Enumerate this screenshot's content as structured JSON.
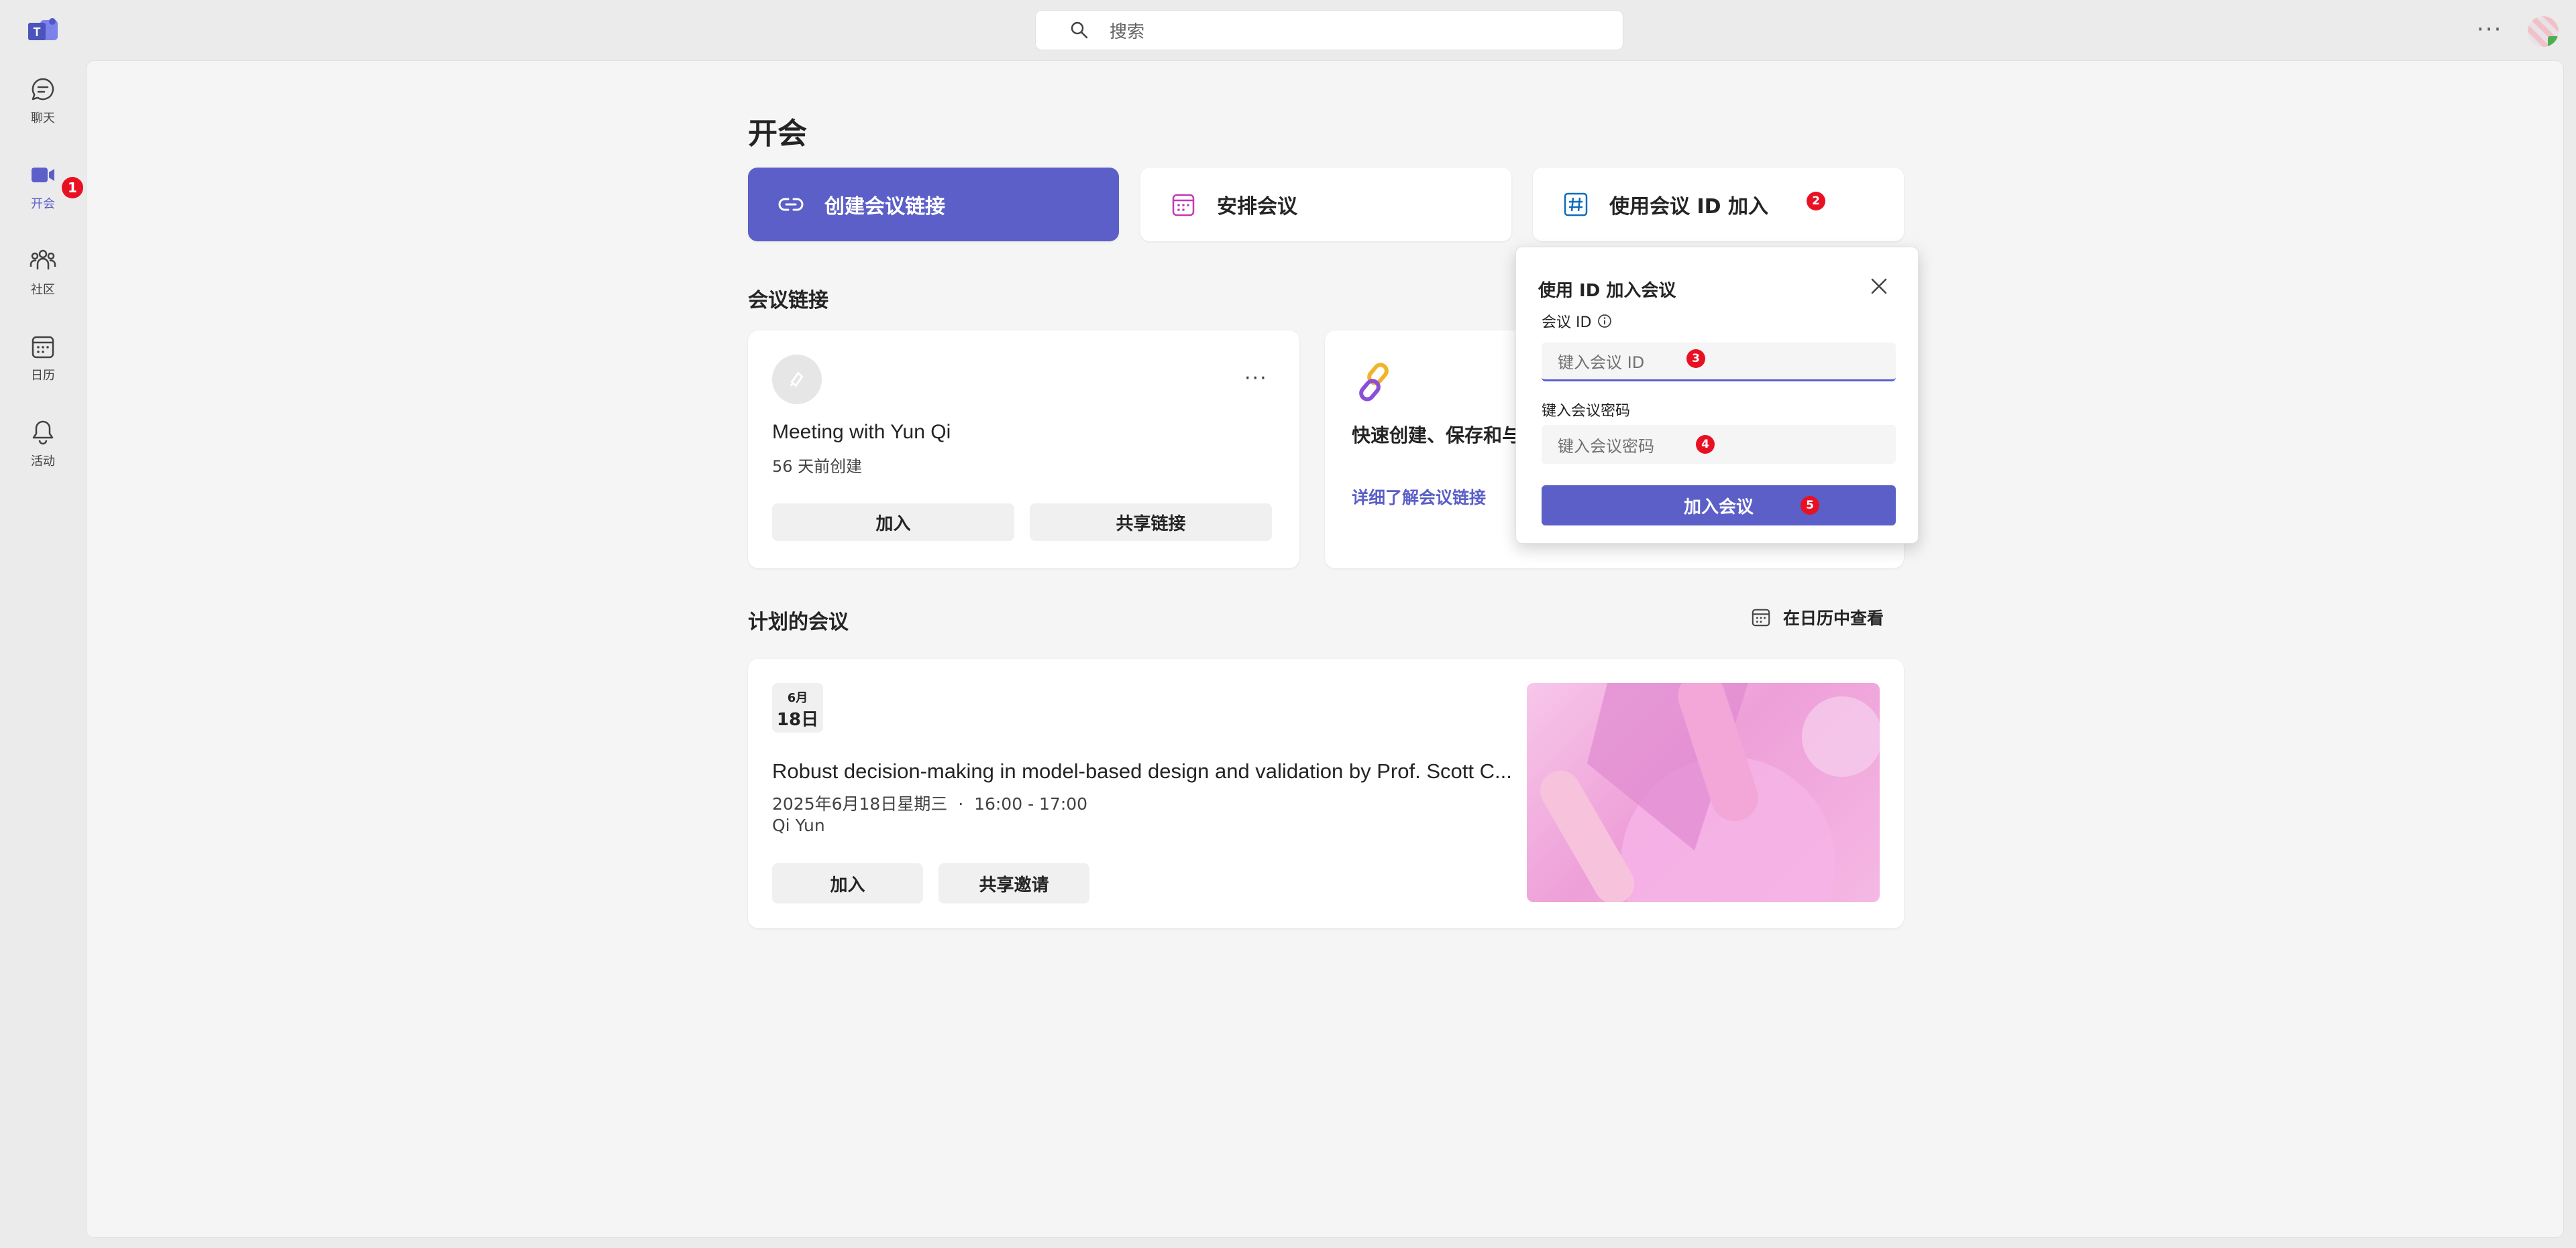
{
  "app": {
    "logo_icon": "teams-logo-icon",
    "search_placeholder": "搜索",
    "more_label": "···"
  },
  "rail": [
    {
      "label": "聊天",
      "icon": "chat-icon"
    },
    {
      "label": "开会",
      "icon": "video-icon",
      "badge": "1"
    },
    {
      "label": "社区",
      "icon": "people-icon"
    },
    {
      "label": "日历",
      "icon": "calendar-icon"
    },
    {
      "label": "活动",
      "icon": "bell-icon"
    }
  ],
  "page": {
    "title": "开会",
    "actions": {
      "create_link": "创建会议链接",
      "schedule": "安排会议",
      "join_by_id": "使用会议 ID 加入",
      "join_by_id_badge": "2"
    }
  },
  "links_section": {
    "title": "会议链接",
    "card1": {
      "name": "Meeting with Yun Qi",
      "created": "56 天前创建",
      "more": "···",
      "join": "加入",
      "share": "共享链接"
    },
    "card2": {
      "title": "快速创建、保存和与",
      "learn_more": "详细了解会议链接"
    }
  },
  "scheduled_section": {
    "title": "计划的会议",
    "view_calendar": "在日历中查看",
    "meeting": {
      "month": "6月",
      "day": "18日",
      "title": "Robust decision-making in model-based design and validation by Prof. Scott C...",
      "datetime": "2025年6月18日星期三  ·  16:00 - 17:00",
      "organizer": "Qi Yun",
      "join": "加入",
      "share_invite": "共享邀请"
    }
  },
  "popup": {
    "title": "使用 ID 加入会议",
    "id_label": "会议 ID",
    "id_placeholder": "键入会议 ID",
    "id_badge": "3",
    "password_label": "键入会议密码",
    "password_placeholder": "键入会议密码",
    "password_badge": "4",
    "join_button": "加入会议",
    "join_badge": "5"
  },
  "colors": {
    "brand": "#5b5fc7",
    "badge": "#e81123",
    "page_bg": "#f5f5f5"
  }
}
